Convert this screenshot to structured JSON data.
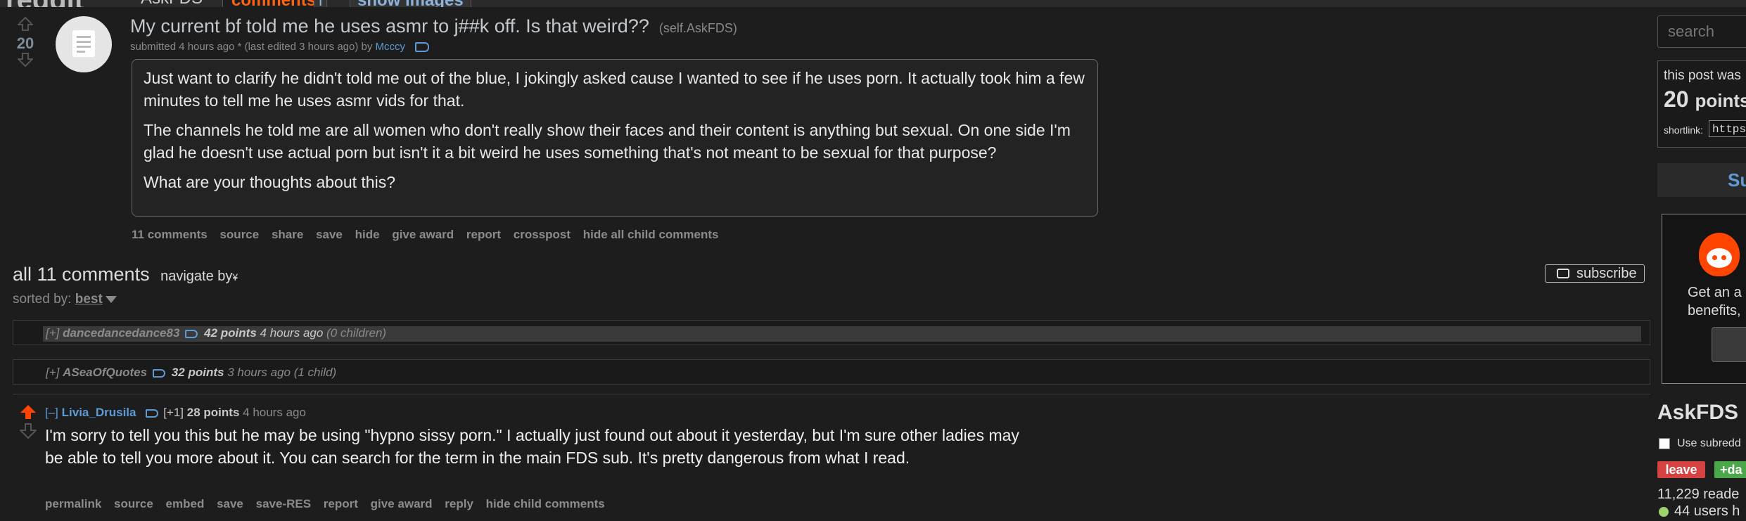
{
  "header": {
    "site_logo": "reddit",
    "subreddit": "AskFDS",
    "tab_comments": "comments",
    "tab_info": "i",
    "tab_images": "show images"
  },
  "post": {
    "score": "20",
    "title": "My current bf told me he uses asmr to j##k off. Is that weird??",
    "domain": "(self.AskFDS)",
    "tagline_prefix": "submitted 4 hours ago * (last edited 3 hours ago) by",
    "author": "Mcccy",
    "paragraphs": [
      "Just want to clarify he didn't told me out of the blue, I jokingly asked cause I wanted to see if he uses porn. It actually took him a few minutes to tell me he uses asmr vids for that.",
      "The channels he told me are all women who don't really show their faces and their content is anything but sexual. On one side I'm glad he doesn't use actual porn but isn't it a bit weird he uses something that's not meant to be sexual for that purpose?",
      "What are your thoughts about this?"
    ],
    "buttons": [
      "11 comments",
      "source",
      "share",
      "save",
      "hide",
      "give award",
      "report",
      "crosspost",
      "hide all child comments"
    ]
  },
  "comments_area": {
    "heading": "all 11 comments",
    "navigate": "navigate by",
    "navigate_glyph": "¥",
    "sorted_label": "sorted by:",
    "sort_value": "best",
    "subscribe": "subscribe"
  },
  "comments": [
    {
      "toggle": "[+]",
      "author": "dancedancedance83",
      "points": "42 points",
      "time": "4 hours ago",
      "children": "(0 children)"
    },
    {
      "toggle": "[+]",
      "author": "ASeaOfQuotes",
      "points": "32 points",
      "time": "3 hours ago",
      "children": "(1 child)"
    },
    {
      "toggle": "[–]",
      "author": "Livia_Drusila",
      "flair": "[+1]",
      "points": "28 points",
      "time": "4 hours ago",
      "body": "I'm sorry to tell you this but he may be using \"hypno sissy porn.\" I actually just found out about it yesterday, but I'm sure other ladies may be able to tell you more about it. You can search for the term in the main FDS sub. It's pretty dangerous from what I read.",
      "buttons": [
        "permalink",
        "source",
        "embed",
        "save",
        "save-RES",
        "report",
        "give award",
        "reply",
        "hide child comments"
      ]
    }
  ],
  "sidebar": {
    "search_placeholder": "search",
    "linkinfo_line1": "this post was",
    "linkinfo_points": "20",
    "linkinfo_points_label": "points",
    "shortlink_label": "shortlink:",
    "shortlink_value": "https",
    "submit_label": "Su",
    "premium_line1": "Get an a",
    "premium_line2": "benefits,",
    "subreddit_title": "AskFDS",
    "use_style_label": "Use subredd",
    "leave_label": "leave",
    "dash_label": "+da",
    "readers": "11,229 reade",
    "users_online": "44 users h"
  },
  "colors": {
    "accent_orange": "#ff4500",
    "link_blue": "#5e9bd6",
    "leave_red": "#d64242",
    "online_green": "#9dd36a"
  }
}
